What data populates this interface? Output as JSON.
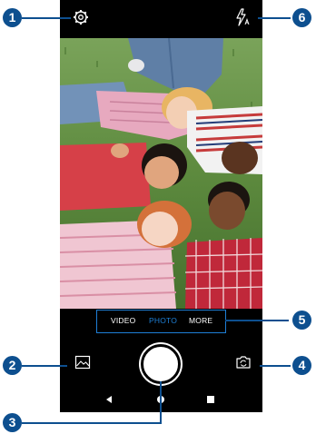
{
  "camera": {
    "modes": [
      "VIDEO",
      "PHOTO",
      "MORE"
    ],
    "active_mode": "PHOTO",
    "colors": {
      "accent": "#1e7fd6",
      "active_mode_text": "#1e7fd6",
      "mode_text": "#ffffff",
      "callout": "#0d4f8f"
    }
  },
  "callouts": [
    "1",
    "2",
    "3",
    "4",
    "5",
    "6"
  ],
  "icons": {
    "settings": "gear-icon",
    "flash": "flash-auto-icon",
    "gallery": "gallery-thumbnail-icon",
    "switch_camera": "switch-camera-icon",
    "back": "back-icon",
    "home": "home-icon",
    "recents": "recents-icon"
  }
}
